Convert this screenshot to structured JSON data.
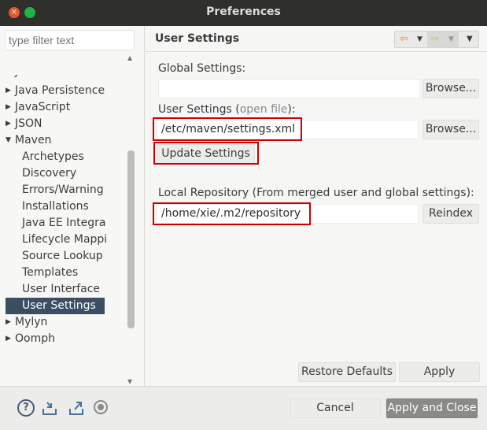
{
  "window": {
    "title": "Preferences"
  },
  "sidebar": {
    "filter_placeholder": "type filter text",
    "items": [
      {
        "label": "Java EE",
        "level": 0,
        "arrow": "",
        "state": "cut"
      },
      {
        "label": "Java Persistence",
        "level": 0,
        "arrow": "collapsed"
      },
      {
        "label": "JavaScript",
        "level": 0,
        "arrow": "collapsed"
      },
      {
        "label": "JSON",
        "level": 0,
        "arrow": "collapsed"
      },
      {
        "label": "Maven",
        "level": 0,
        "arrow": "expanded"
      },
      {
        "label": "Archetypes",
        "level": 1
      },
      {
        "label": "Discovery",
        "level": 1
      },
      {
        "label": "Errors/Warning",
        "level": 1
      },
      {
        "label": "Installations",
        "level": 1
      },
      {
        "label": "Java EE Integra",
        "level": 1
      },
      {
        "label": "Lifecycle Mappi",
        "level": 1
      },
      {
        "label": "Source Lookup",
        "level": 1
      },
      {
        "label": "Templates",
        "level": 1
      },
      {
        "label": "User Interface",
        "level": 1
      },
      {
        "label": "User Settings",
        "level": 1,
        "selected": true
      },
      {
        "label": "Mylyn",
        "level": 0,
        "arrow": "collapsed"
      },
      {
        "label": "Oomph",
        "level": 0,
        "arrow": "collapsed"
      }
    ]
  },
  "main": {
    "title": "User Settings",
    "global_label": "Global Settings:",
    "global_value": "",
    "browse_label": "Browse...",
    "user_label_prefix": "User Settings (",
    "user_label_link": "open file",
    "user_label_suffix": "):",
    "user_value": "/etc/maven/settings.xml",
    "update_label": "Update Settings",
    "local_label": "Local Repository (From merged user and global settings):",
    "local_value": "/home/xie/.m2/repository",
    "reindex_label": "Reindex",
    "restore_label": "Restore Defaults",
    "apply_label": "Apply"
  },
  "footer": {
    "cancel_label": "Cancel",
    "apply_close_label": "Apply and Close"
  },
  "colors": {
    "titlebar": "#2f2f2b",
    "selection": "#3c4e63",
    "highlight_box": "#cc0000",
    "primary_button": "#8a8a88"
  }
}
